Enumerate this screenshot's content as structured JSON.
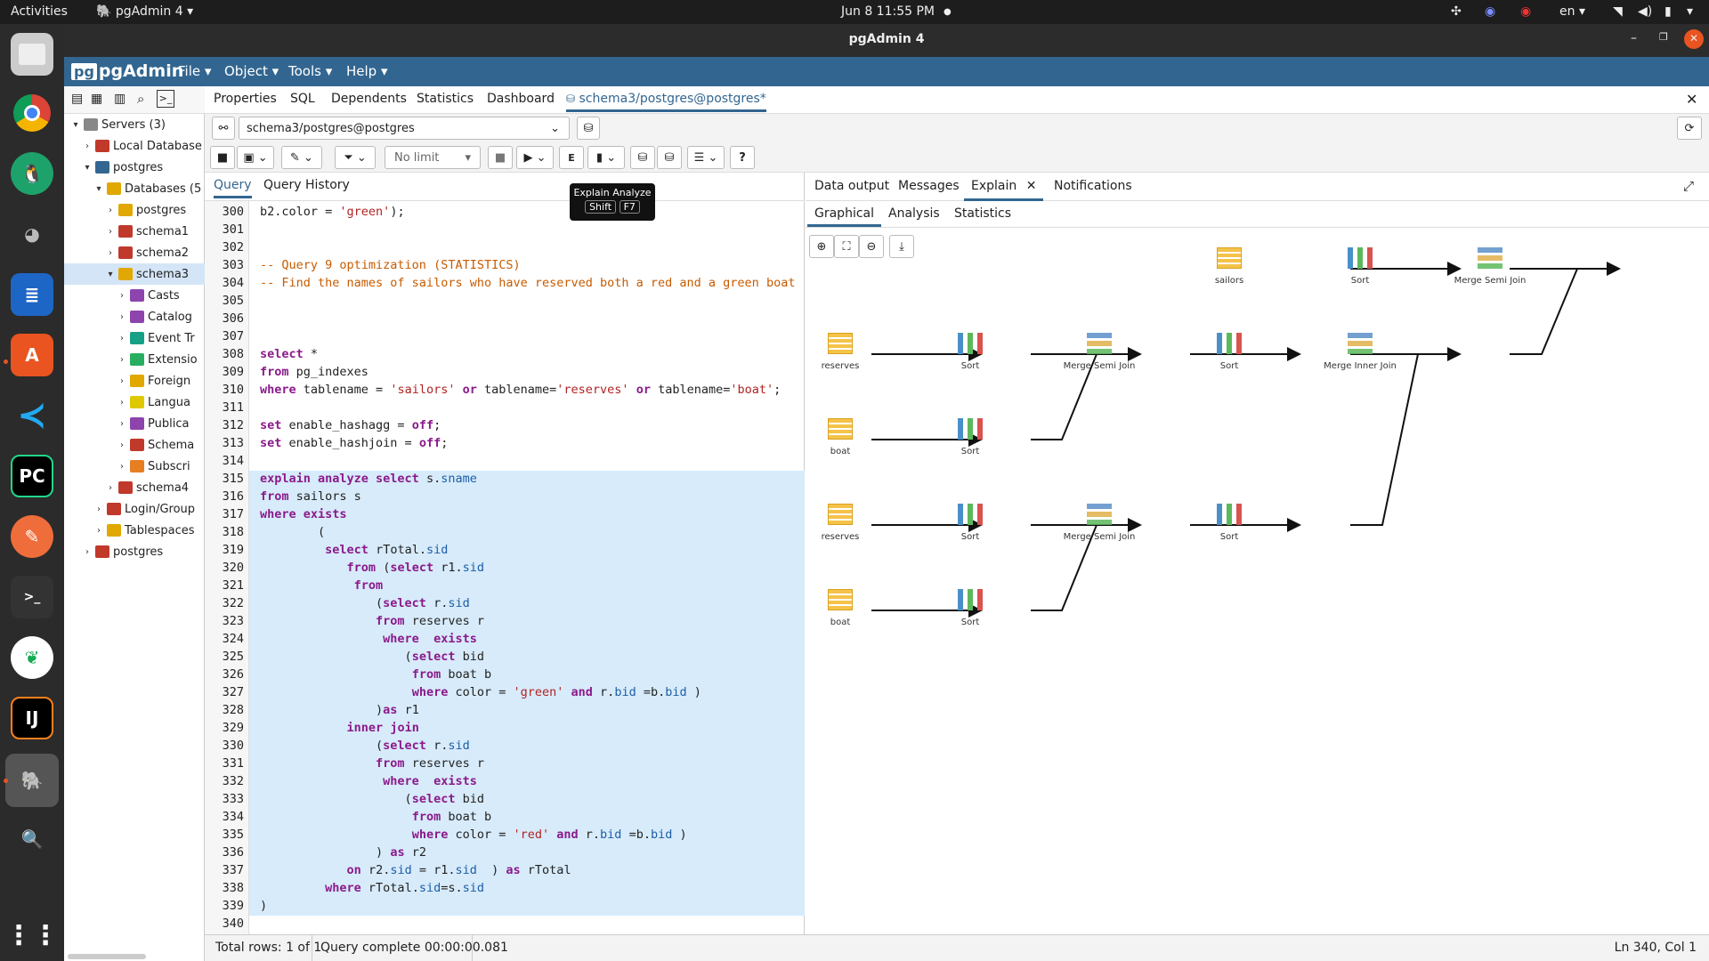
{
  "topbar": {
    "activities": "Activities",
    "app": "pgAdmin 4",
    "datetime": "Jun 8  11:55 PM",
    "lang": "en"
  },
  "window": {
    "title": "pgAdmin 4"
  },
  "menu": {
    "logo": "pgAdmin",
    "file": "File",
    "object": "Object",
    "tools": "Tools",
    "help": "Help"
  },
  "tree": [
    {
      "label": "Servers (3)",
      "indent": 0,
      "tw": "▾",
      "color": "#888"
    },
    {
      "label": "Local Database",
      "indent": 1,
      "tw": "›",
      "color": "#c0392b"
    },
    {
      "label": "postgres",
      "indent": 1,
      "tw": "▾",
      "color": "#336791"
    },
    {
      "label": "Databases (5",
      "indent": 2,
      "tw": "▾",
      "color": "#e0a800"
    },
    {
      "label": "postgres",
      "indent": 3,
      "tw": "›",
      "color": "#e0a800"
    },
    {
      "label": "schema1",
      "indent": 3,
      "tw": "›",
      "color": "#c0392b"
    },
    {
      "label": "schema2",
      "indent": 3,
      "tw": "›",
      "color": "#c0392b"
    },
    {
      "label": "schema3",
      "indent": 3,
      "tw": "▾",
      "color": "#e0a800",
      "sel": true
    },
    {
      "label": "Casts",
      "indent": 4,
      "tw": "›",
      "color": "#8e44ad"
    },
    {
      "label": "Catalog",
      "indent": 4,
      "tw": "›",
      "color": "#8e44ad"
    },
    {
      "label": "Event Tr",
      "indent": 4,
      "tw": "›",
      "color": "#16a085"
    },
    {
      "label": "Extensio",
      "indent": 4,
      "tw": "›",
      "color": "#27ae60"
    },
    {
      "label": "Foreign",
      "indent": 4,
      "tw": "›",
      "color": "#e0a800"
    },
    {
      "label": "Langua",
      "indent": 4,
      "tw": "›",
      "color": "#e0c800"
    },
    {
      "label": "Publica",
      "indent": 4,
      "tw": "›",
      "color": "#8e44ad"
    },
    {
      "label": "Schema",
      "indent": 4,
      "tw": "›",
      "color": "#c0392b"
    },
    {
      "label": "Subscri",
      "indent": 4,
      "tw": "›",
      "color": "#e67e22"
    },
    {
      "label": "schema4",
      "indent": 3,
      "tw": "›",
      "color": "#c0392b"
    },
    {
      "label": "Login/Group",
      "indent": 2,
      "tw": "›",
      "color": "#c0392b"
    },
    {
      "label": "Tablespaces",
      "indent": 2,
      "tw": "›",
      "color": "#e0a800"
    },
    {
      "label": "postgres",
      "indent": 1,
      "tw": "›",
      "color": "#c0392b"
    }
  ],
  "tabs": {
    "properties": "Properties",
    "sql": "SQL",
    "dependents": "Dependents",
    "statistics": "Statistics",
    "dashboard": "Dashboard",
    "query_tool": "schema3/postgres@postgres*"
  },
  "connection": {
    "value": "schema3/postgres@postgres"
  },
  "toolbar": {
    "limit": "No limit"
  },
  "editor": {
    "tab_query": "Query",
    "tab_history": "Query History"
  },
  "tooltip": {
    "title": "Explain Analyze",
    "key1": "Shift",
    "key2": "F7"
  },
  "code": [
    {
      "n": "300",
      "h": "b2.color = <span class=\"st\">'green'</span>);"
    },
    {
      "n": "301",
      "h": ""
    },
    {
      "n": "302",
      "h": ""
    },
    {
      "n": "303",
      "h": "<span class=\"cm\">-- Query 9 optimization (STATISTICS)</span>"
    },
    {
      "n": "304",
      "h": "<span class=\"cm\">-- Find the names of sailors who have reserved both a red and a green boat</span>"
    },
    {
      "n": "305",
      "h": ""
    },
    {
      "n": "306",
      "h": ""
    },
    {
      "n": "307",
      "h": ""
    },
    {
      "n": "308",
      "h": "<span class=\"kw\">select</span> *"
    },
    {
      "n": "309",
      "h": "<span class=\"kw\">from</span> pg_indexes"
    },
    {
      "n": "310",
      "h": "<span class=\"kw\">where</span> tablename = <span class=\"st\">'sailors'</span> <span class=\"kw\">or</span> tablename=<span class=\"st\">'reserves'</span> <span class=\"kw\">or</span> tablename=<span class=\"st\">'boat'</span>;"
    },
    {
      "n": "311",
      "h": ""
    },
    {
      "n": "312",
      "h": "<span class=\"kw\">set</span> enable_hashagg = <span class=\"kw\">off</span>;"
    },
    {
      "n": "313",
      "h": "<span class=\"kw\">set</span> enable_hashjoin = <span class=\"kw\">off</span>;"
    },
    {
      "n": "314",
      "h": ""
    },
    {
      "n": "315",
      "h": "<span class=\"kw\">explain analyze select</span> s.<span class=\"fn\">sname</span>",
      "hl": true
    },
    {
      "n": "316",
      "h": "<span class=\"kw\">from</span> sailors s",
      "hl": true
    },
    {
      "n": "317",
      "h": "<span class=\"kw\">where exists</span>",
      "hl": true
    },
    {
      "n": "318",
      "h": "        (",
      "hl": true
    },
    {
      "n": "319",
      "h": "         <span class=\"kw\">select</span> rTotal.<span class=\"fn\">sid</span>",
      "hl": true
    },
    {
      "n": "320",
      "h": "            <span class=\"kw\">from</span> (<span class=\"kw\">select</span> r1.<span class=\"fn\">sid</span>",
      "hl": true
    },
    {
      "n": "321",
      "h": "             <span class=\"kw\">from</span>",
      "hl": true
    },
    {
      "n": "322",
      "h": "                (<span class=\"kw\">select</span> r.<span class=\"fn\">sid</span>",
      "hl": true
    },
    {
      "n": "323",
      "h": "                <span class=\"kw\">from</span> reserves r",
      "hl": true
    },
    {
      "n": "324",
      "h": "                 <span class=\"kw\">where  exists</span>",
      "hl": true
    },
    {
      "n": "325",
      "h": "                    (<span class=\"kw\">select</span> bid",
      "hl": true
    },
    {
      "n": "326",
      "h": "                     <span class=\"kw\">from</span> boat b",
      "hl": true
    },
    {
      "n": "327",
      "h": "                     <span class=\"kw\">where</span> color = <span class=\"st\">'green'</span> <span class=\"kw\">and</span> r.<span class=\"fn\">bid</span> =b.<span class=\"fn\">bid</span> )",
      "hl": true
    },
    {
      "n": "328",
      "h": "                )<span class=\"kw\">as</span> r1",
      "hl": true
    },
    {
      "n": "329",
      "h": "            <span class=\"kw\">inner join</span>",
      "hl": true
    },
    {
      "n": "330",
      "h": "                (<span class=\"kw\">select</span> r.<span class=\"fn\">sid</span>",
      "hl": true
    },
    {
      "n": "331",
      "h": "                <span class=\"kw\">from</span> reserves r",
      "hl": true
    },
    {
      "n": "332",
      "h": "                 <span class=\"kw\">where  exists</span>",
      "hl": true
    },
    {
      "n": "333",
      "h": "                    (<span class=\"kw\">select</span> bid",
      "hl": true
    },
    {
      "n": "334",
      "h": "                     <span class=\"kw\">from</span> boat b",
      "hl": true
    },
    {
      "n": "335",
      "h": "                     <span class=\"kw\">where</span> color = <span class=\"st\">'red'</span> <span class=\"kw\">and</span> r.<span class=\"fn\">bid</span> =b.<span class=\"fn\">bid</span> )",
      "hl": true
    },
    {
      "n": "336",
      "h": "                ) <span class=\"kw\">as</span> r2",
      "hl": true
    },
    {
      "n": "337",
      "h": "            <span class=\"kw\">on</span> r2.<span class=\"fn\">sid</span> = r1.<span class=\"fn\">sid</span>  ) <span class=\"kw\">as</span> rTotal",
      "hl": true
    },
    {
      "n": "338",
      "h": "         <span class=\"kw\">where</span> rTotal.<span class=\"fn\">sid</span>=s.<span class=\"fn\">sid</span>",
      "hl": true
    },
    {
      "n": "339",
      "h": ")",
      "hl": true
    },
    {
      "n": "340",
      "h": ""
    }
  ],
  "results": {
    "tab_data": "Data output",
    "tab_messages": "Messages",
    "tab_explain": "Explain",
    "tab_notifications": "Notifications",
    "sub_graphical": "Graphical",
    "sub_analysis": "Analysis",
    "sub_statistics": "Statistics"
  },
  "plan": [
    {
      "label": "sailors",
      "kind": "tbl"
    },
    {
      "label": "Sort",
      "kind": "sort"
    },
    {
      "label": "Merge Semi Join",
      "kind": "join"
    },
    {
      "label": "reserves",
      "kind": "tbl"
    },
    {
      "label": "Sort",
      "kind": "sort"
    },
    {
      "label": "Merge Semi Join",
      "kind": "join"
    },
    {
      "label": "Sort",
      "kind": "sort"
    },
    {
      "label": "Merge Inner Join",
      "kind": "join"
    },
    {
      "label": "boat",
      "kind": "tbl"
    },
    {
      "label": "Sort",
      "kind": "sort"
    },
    {
      "label": "reserves",
      "kind": "tbl"
    },
    {
      "label": "Sort",
      "kind": "sort"
    },
    {
      "label": "Merge Semi Join",
      "kind": "join"
    },
    {
      "label": "Sort",
      "kind": "sort"
    },
    {
      "label": "boat",
      "kind": "tbl"
    },
    {
      "label": "Sort",
      "kind": "sort"
    }
  ],
  "status": {
    "rows": "Total rows: 1 of 1",
    "complete": "Query complete 00:00:00.081",
    "cursor": "Ln 340, Col 1"
  }
}
